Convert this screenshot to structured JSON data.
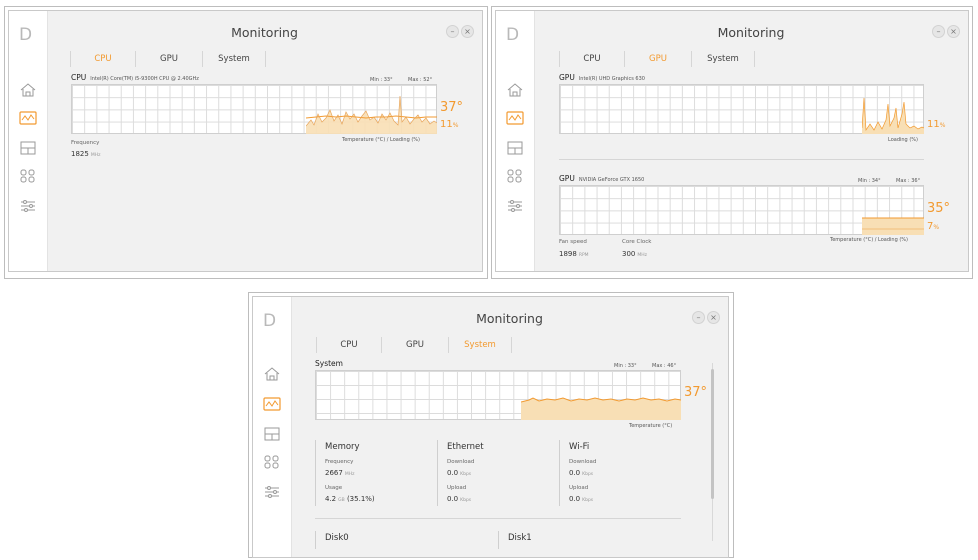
{
  "colors": {
    "accent": "#f29a30",
    "fill": "#f8dfb5",
    "nav_active_border": "#f29a30"
  },
  "nav_icons": [
    "logo-d-icon",
    "home-icon",
    "monitoring-icon",
    "layout-icon",
    "apps-icon",
    "settings-sliders-icon"
  ],
  "win1": {
    "title": "Monitoring",
    "min_btn": "–",
    "close_btn": "×",
    "tabs": [
      "CPU",
      "GPU",
      "System"
    ],
    "active_tab": "CPU",
    "cpu_label": "CPU",
    "cpu_model": "Intel(R) Core(TM) i5-9300H CPU @ 2.40GHz",
    "min": "Min : 33°",
    "max": "Max : 52°",
    "temp_value": "37°",
    "load_value": "11",
    "load_unit": "%",
    "caption": "Temperature (°C) / Loading (%)",
    "freq_label": "Frequency",
    "freq_value": "1825",
    "freq_unit": "MHz"
  },
  "win2": {
    "title": "Monitoring",
    "min_btn": "–",
    "close_btn": "×",
    "tabs": [
      "CPU",
      "GPU",
      "System"
    ],
    "active_tab": "GPU",
    "gpu1_label": "GPU",
    "gpu1_model": "Intel(R) UHD Graphics 630",
    "gpu1_load": "11",
    "gpu1_unit": "%",
    "gpu1_caption": "Loading (%)",
    "gpu2_label": "GPU",
    "gpu2_model": "NVIDIA GeForce GTX 1650",
    "gpu2_min": "Min : 34°",
    "gpu2_max": "Max : 36°",
    "gpu2_temp": "35°",
    "gpu2_load": "7",
    "gpu2_unit": "%",
    "gpu2_caption": "Temperature (°C) / Loading (%)",
    "fan_label": "Fan speed",
    "fan_value": "1898",
    "fan_unit": "RPM",
    "clock_label": "Core Clock",
    "clock_value": "300",
    "clock_unit": "MHz"
  },
  "win3": {
    "title": "Monitoring",
    "min_btn": "–",
    "close_btn": "×",
    "tabs": [
      "CPU",
      "GPU",
      "System"
    ],
    "active_tab": "System",
    "sys_label": "System",
    "min": "Min : 33°",
    "max": "Max : 46°",
    "temp_value": "37°",
    "caption": "Temperature (°C)",
    "memory": {
      "title": "Memory",
      "freq_label": "Frequency",
      "freq_value": "2667",
      "freq_unit": "MHz",
      "usage_label": "Usage",
      "usage_value": "4.2",
      "usage_unit": "GB",
      "usage_pct": "(35.1%)"
    },
    "ethernet": {
      "title": "Ethernet",
      "down_label": "Download",
      "down_value": "0.0",
      "down_unit": "Kbps",
      "up_label": "Upload",
      "up_value": "0.0",
      "up_unit": "Kbps"
    },
    "wifi": {
      "title": "Wi-Fi",
      "down_label": "Download",
      "down_value": "0.0",
      "down_unit": "Kbps",
      "up_label": "Upload",
      "up_value": "0.0",
      "up_unit": "Kbps"
    },
    "disk0": "Disk0",
    "disk1": "Disk1"
  }
}
